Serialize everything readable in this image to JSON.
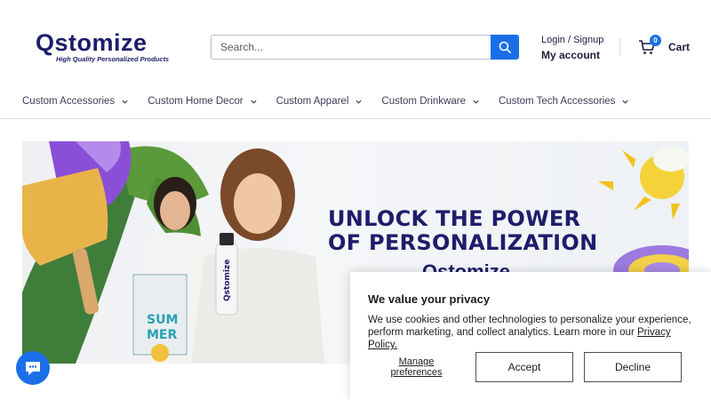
{
  "header": {
    "logo": {
      "wordmark": "Qstomize",
      "tagline": "High Quality Personalized Products"
    },
    "search": {
      "placeholder": "Search..."
    },
    "account": {
      "line1": "Login / Signup",
      "line2": "My account"
    },
    "cart": {
      "count": "0",
      "label": "Cart"
    }
  },
  "nav": {
    "items": [
      {
        "label": "Custom Accessories"
      },
      {
        "label": "Custom Home Decor"
      },
      {
        "label": "Custom Apparel"
      },
      {
        "label": "Custom Drinkware"
      },
      {
        "label": "Custom Tech Accessories"
      }
    ]
  },
  "hero": {
    "title_line1": "UNLOCK THE POWER",
    "title_line2": "OF PERSONALIZATION",
    "brand": "Qstomize"
  },
  "cookie": {
    "title": "We value your privacy",
    "text": "We use cookies and other technologies to personalize your experience, perform marketing, and collect analytics. Learn more in our ",
    "link": "Privacy Policy.",
    "manage": "Manage preferences",
    "accept": "Accept",
    "decline": "Decline"
  },
  "colors": {
    "accent": "#1a6fe8",
    "brand": "#1d1d6b"
  },
  "icons": {
    "search": "search-icon",
    "cart": "cart-icon",
    "chat": "chat-icon"
  }
}
